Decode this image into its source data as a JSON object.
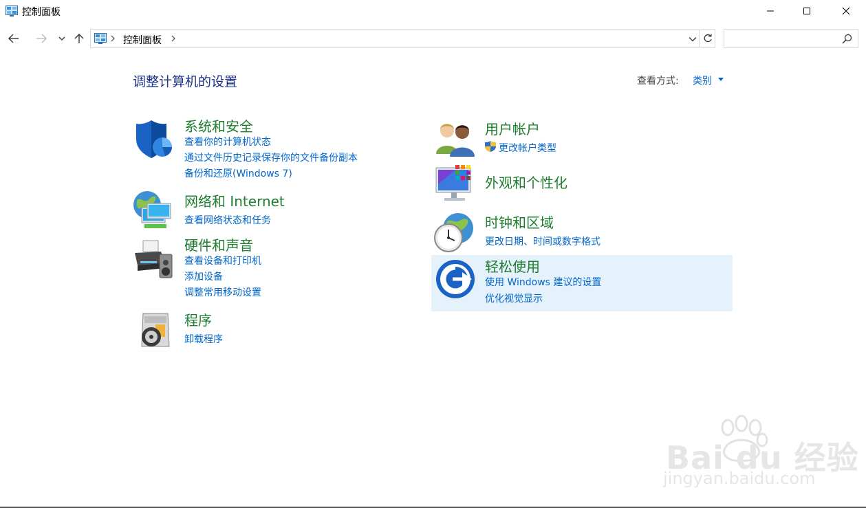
{
  "window": {
    "title": "控制面板"
  },
  "nav": {
    "breadcrumb": "控制面板",
    "search_placeholder": ""
  },
  "header": {
    "title": "调整计算机的设置",
    "view_label": "查看方式:",
    "view_value": "类别"
  },
  "categories": {
    "system": {
      "title": "系统和安全",
      "links": [
        "查看你的计算机状态",
        "通过文件历史记录保存你的文件备份副本",
        "备份和还原(Windows 7)"
      ]
    },
    "network": {
      "title": "网络和 Internet",
      "links": [
        "查看网络状态和任务"
      ]
    },
    "hardware": {
      "title": "硬件和声音",
      "links": [
        "查看设备和打印机",
        "添加设备",
        "调整常用移动设置"
      ]
    },
    "programs": {
      "title": "程序",
      "links": [
        "卸载程序"
      ]
    },
    "users": {
      "title": "用户帐户",
      "links": [
        "更改帐户类型"
      ]
    },
    "appearance": {
      "title": "外观和个性化",
      "links": []
    },
    "clock": {
      "title": "时钟和区域",
      "links": [
        "更改日期、时间或数字格式"
      ]
    },
    "ease": {
      "title": "轻松使用",
      "links": [
        "使用 Windows 建议的设置",
        "优化视觉显示"
      ]
    }
  },
  "watermark": {
    "text1": "Bai du 经验",
    "text2": "jingyan.baidu.com"
  },
  "colors": {
    "link": "#0066cc",
    "category_title": "#1e7d2e",
    "page_title": "#1e3287",
    "highlight": "#e5f1fb"
  }
}
